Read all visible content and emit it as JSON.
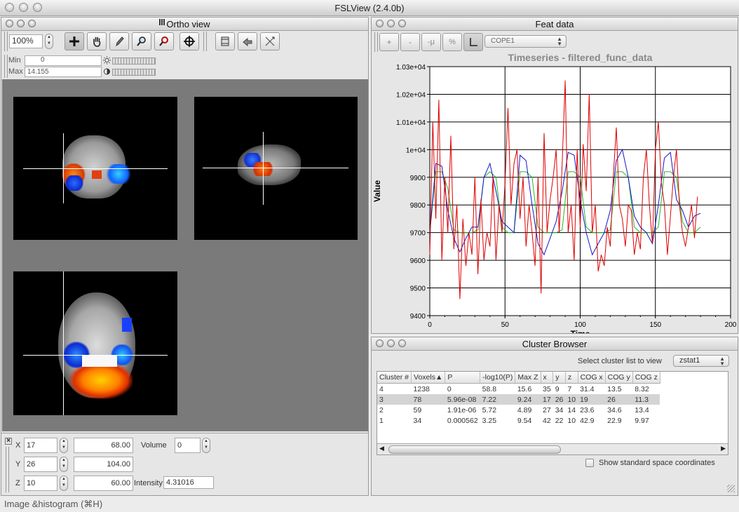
{
  "window": {
    "title": "FSLView (2.4.0b)"
  },
  "ortho": {
    "title": "Ortho view",
    "zoom": "100%",
    "min_label": "Min",
    "min_value": "0",
    "max_label": "Max",
    "max_value": "14.155"
  },
  "coords": {
    "x_label": "X",
    "x_voxel": "17",
    "x_mm": "68.00",
    "y_label": "Y",
    "y_voxel": "26",
    "y_mm": "104.00",
    "z_label": "Z",
    "z_voxel": "10",
    "z_mm": "60.00",
    "volume_label": "Volume",
    "volume_value": "0",
    "intensity_label": "Intensity",
    "intensity_value": "4.31016"
  },
  "feat": {
    "title": "Feat data",
    "btn_plus": "+",
    "btn_minus": "-",
    "btn_mu": "-μ",
    "btn_pct": "%",
    "cope_select": "COPE1"
  },
  "chart_data": {
    "type": "line",
    "title": "Timeseries - filtered_func_data",
    "xlabel": "Time",
    "ylabel": "Value",
    "xlim": [
      0,
      200
    ],
    "ylim": [
      9400,
      10300
    ],
    "xticks": [
      "0",
      "50",
      "100",
      "150",
      "200"
    ],
    "yticks": [
      "9400",
      "9500",
      "9600",
      "9700",
      "9800",
      "9900",
      "1e+04",
      "1.01e+04",
      "1.02e+04",
      "1.03e+04"
    ],
    "grid": true,
    "series": [
      {
        "color": "#dd0000",
        "x": [
          0,
          2,
          4,
          6,
          8,
          10,
          12,
          14,
          16,
          18,
          20,
          22,
          24,
          26,
          28,
          30,
          32,
          34,
          36,
          38,
          40,
          42,
          44,
          46,
          48,
          50,
          52,
          54,
          56,
          58,
          60,
          62,
          64,
          66,
          68,
          70,
          72,
          74,
          76,
          78,
          80,
          82,
          84,
          86,
          88,
          90,
          92,
          94,
          96,
          98,
          100,
          102,
          104,
          106,
          108,
          110,
          112,
          114,
          116,
          118,
          120,
          122,
          124,
          126,
          128,
          130,
          132,
          134,
          136,
          138,
          140,
          142,
          144,
          146,
          148,
          150,
          152,
          154,
          156,
          158,
          160,
          162,
          164,
          166,
          168,
          170,
          172,
          174,
          176,
          178
        ],
        "values": [
          9620,
          10100,
          9750,
          10180,
          9600,
          9900,
          9700,
          10050,
          9640,
          9800,
          9460,
          9750,
          9580,
          9700,
          9620,
          9900,
          9550,
          9820,
          9600,
          9700,
          9650,
          9900,
          9600,
          9800,
          9700,
          9880,
          10150,
          9800,
          9950,
          10000,
          9750,
          9900,
          9650,
          9800,
          9700,
          9580,
          9900,
          9480,
          10060,
          9700,
          9820,
          9900,
          10000,
          9700,
          9950,
          10250,
          9700,
          9800,
          9600,
          10000,
          9720,
          10020,
          9850,
          10200,
          9700,
          9800,
          9560,
          9620,
          9580,
          9720,
          9650,
          9900,
          10080,
          9800,
          9750,
          9650,
          9800,
          9780,
          9620,
          9700,
          9640,
          9900,
          10000,
          9800,
          9660,
          10000,
          10100,
          9880,
          9800,
          9620,
          9760,
          9900,
          10000,
          9800,
          9700,
          9650,
          9720,
          9800,
          9680,
          9830
        ]
      },
      {
        "color": "#1414c8",
        "x": [
          0,
          4,
          8,
          12,
          16,
          20,
          24,
          28,
          32,
          36,
          40,
          44,
          48,
          52,
          56,
          60,
          64,
          68,
          72,
          76,
          80,
          84,
          88,
          92,
          96,
          100,
          104,
          108,
          112,
          116,
          120,
          124,
          128,
          132,
          136,
          140,
          144,
          148,
          152,
          156,
          160,
          164,
          168,
          172,
          176,
          180
        ],
        "values": [
          9700,
          9950,
          9940,
          9780,
          9680,
          9630,
          9680,
          9720,
          9720,
          9900,
          9950,
          9850,
          9740,
          9720,
          9700,
          9980,
          9960,
          9800,
          9660,
          9620,
          9680,
          9740,
          9850,
          9990,
          9980,
          9820,
          9700,
          9620,
          9660,
          9700,
          9780,
          9960,
          10000,
          9900,
          9760,
          9720,
          9700,
          9660,
          9800,
          9970,
          9990,
          9820,
          9780,
          9720,
          9760,
          9770
        ]
      },
      {
        "color": "#22bb22",
        "x": [
          0,
          4,
          8,
          12,
          16,
          20,
          24,
          28,
          32,
          36,
          40,
          44,
          48,
          52,
          56,
          60,
          64,
          68,
          72,
          76,
          80,
          84,
          88,
          92,
          96,
          100,
          104,
          108,
          112,
          116,
          120,
          124,
          128,
          132,
          136,
          140,
          144,
          148,
          152,
          156,
          160,
          164,
          168,
          172,
          176,
          180
        ],
        "values": [
          9700,
          9920,
          9920,
          9860,
          9710,
          9700,
          9700,
          9700,
          9710,
          9900,
          9920,
          9900,
          9720,
          9700,
          9700,
          9920,
          9920,
          9900,
          9720,
          9700,
          9700,
          9700,
          9710,
          9920,
          9920,
          9900,
          9720,
          9700,
          9700,
          9700,
          9710,
          9920,
          9920,
          9900,
          9720,
          9700,
          9700,
          9700,
          9720,
          9920,
          9920,
          9900,
          9740,
          9700,
          9700,
          9720
        ]
      }
    ]
  },
  "cluster": {
    "title": "Cluster Browser",
    "select_label": "Select cluster list to view",
    "select_value": "zstat1",
    "columns": [
      "Cluster #",
      "Voxels▲",
      "P",
      "-log10(P)",
      "Max Z",
      "x",
      "y",
      "z",
      "COG x",
      "COG y",
      "COG z"
    ],
    "rows": [
      [
        "4",
        "1238",
        "0",
        "58.8",
        "15.6",
        "35",
        "9",
        "7",
        "31.4",
        "13.5",
        "8.32"
      ],
      [
        "3",
        "78",
        "5.96e-08",
        "7.22",
        "9.24",
        "17",
        "26",
        "10",
        "19",
        "26",
        "11.3"
      ],
      [
        "2",
        "59",
        "1.91e-06",
        "5.72",
        "4.89",
        "27",
        "34",
        "14",
        "23.6",
        "34.6",
        "13.4"
      ],
      [
        "1",
        "34",
        "0.000562",
        "3.25",
        "9.54",
        "42",
        "22",
        "10",
        "42.9",
        "22.9",
        "9.97"
      ]
    ],
    "std_coords_label": "Show standard space coordinates"
  },
  "status": {
    "text": "Image &histogram (⌘H)"
  }
}
